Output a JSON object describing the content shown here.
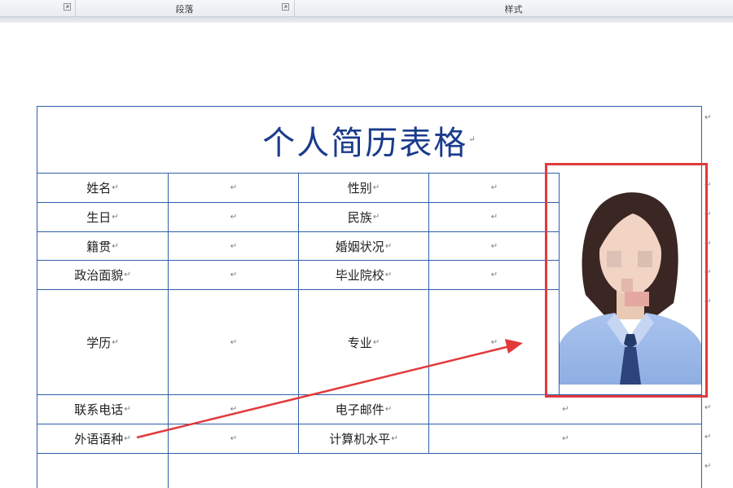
{
  "ribbon": {
    "groups": [
      {
        "label": ""
      },
      {
        "label": "段落"
      },
      {
        "label": "样式"
      }
    ]
  },
  "document": {
    "title": "个人简历表格",
    "rows": [
      {
        "label1": "姓名",
        "label2": "性别"
      },
      {
        "label1": "生日",
        "label2": "民族"
      },
      {
        "label1": "籍贯",
        "label2": "婚姻状况"
      },
      {
        "label1": "政治面貌",
        "label2": "毕业院校"
      },
      {
        "label1": "学历",
        "label2": "专业"
      },
      {
        "label1": "联系电话",
        "label2": "电子邮件"
      },
      {
        "label1": "外语语种",
        "label2": "计算机水平"
      }
    ],
    "paragraph_mark": "↵"
  },
  "annotation": {
    "highlight_color": "#e2393b",
    "table_line_color": "#2f5faa",
    "title_color": "#1a3b8c"
  }
}
